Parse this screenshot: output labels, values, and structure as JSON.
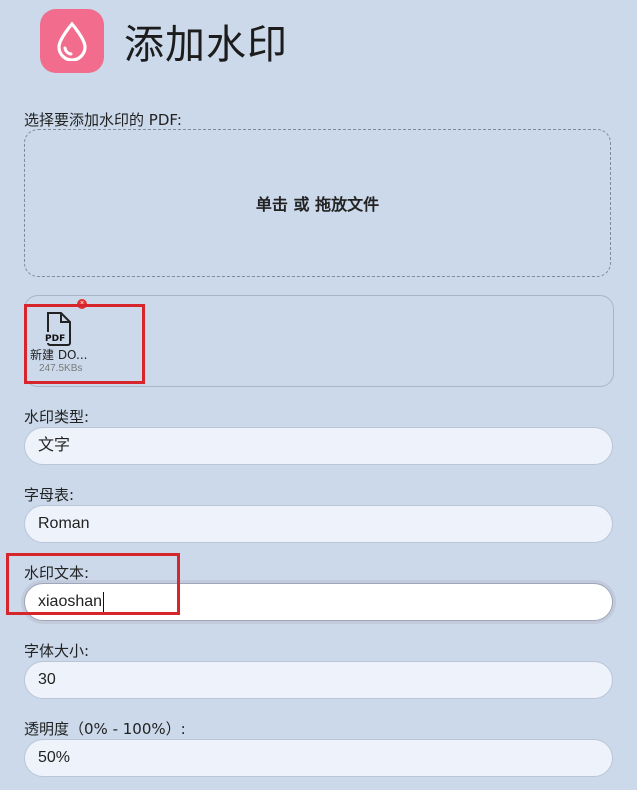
{
  "header": {
    "title": "添加水印",
    "icon": "water-drop-icon",
    "icon_bg": "#f26d8d"
  },
  "upload": {
    "label": "选择要添加水印的 PDF:",
    "dropzone_text": "单击 或 拖放文件",
    "file": {
      "icon_text": "PDF",
      "name": "新建 DO...",
      "size": "247.5KBs"
    }
  },
  "fields": {
    "watermark_type": {
      "label": "水印类型:",
      "value": "文字"
    },
    "alphabet": {
      "label": "字母表:",
      "value": "Roman"
    },
    "watermark_text": {
      "label": "水印文本:",
      "value": "xiaoshan"
    },
    "font_size": {
      "label": "字体大小:",
      "value": "30"
    },
    "opacity": {
      "label": "透明度（0% - 100%）:",
      "value": "50%"
    }
  },
  "colors": {
    "background": "#cbd9ea",
    "highlight": "#d7262b",
    "accent": "#f26d8d"
  }
}
